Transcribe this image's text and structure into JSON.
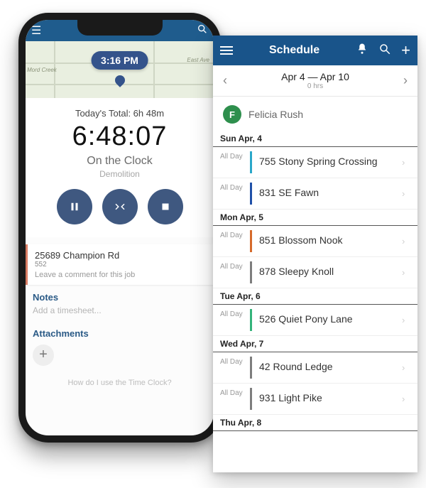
{
  "colors": {
    "brand": "#19548a",
    "pill": "#34538b",
    "circleBtn": "#3f5880",
    "avatar": "#2e8f4d"
  },
  "phone1": {
    "map_time": "3:16 PM",
    "today_label": "Today's Total: 6h 48m",
    "elapsed": "6:48:07",
    "status": "On the Clock",
    "task": "Demolition",
    "job": {
      "addr": "25689 Champion Rd",
      "num": "552",
      "comment_ph": "Leave a comment for this job"
    },
    "notes_hdr": "Notes",
    "add_timesheet_ph": "Add a timesheet...",
    "attach_hdr": "Attachments",
    "help": "How do I use the Time Clock?",
    "roads": [
      "Mord Creek",
      "East Ave"
    ]
  },
  "phone2": {
    "title": "Schedule",
    "range": "Apr 4 — Apr 10",
    "range_hours": "0 hrs",
    "person": {
      "initial": "F",
      "name": "Felicia Rush"
    },
    "allday": "All Day",
    "days": [
      {
        "label": "Sun Apr, 4",
        "events": [
          {
            "title": "755 Stony Spring Crossing",
            "color": "#2aa7c9"
          },
          {
            "title": "831 SE Fawn",
            "color": "#2051a8"
          }
        ]
      },
      {
        "label": "Mon Apr, 5",
        "events": [
          {
            "title": "851 Blossom Nook",
            "color": "#d66a2b"
          },
          {
            "title": "878 Sleepy Knoll",
            "color": "#7d7d7d"
          }
        ]
      },
      {
        "label": "Tue Apr, 6",
        "events": [
          {
            "title": "526 Quiet Pony Lane",
            "color": "#34b37a"
          }
        ]
      },
      {
        "label": "Wed Apr, 7",
        "events": [
          {
            "title": "42 Round Ledge",
            "color": "#7d7d7d"
          },
          {
            "title": "931 Light Pike",
            "color": "#7d7d7d"
          }
        ]
      },
      {
        "label": "Thu Apr, 8",
        "events": []
      }
    ]
  }
}
